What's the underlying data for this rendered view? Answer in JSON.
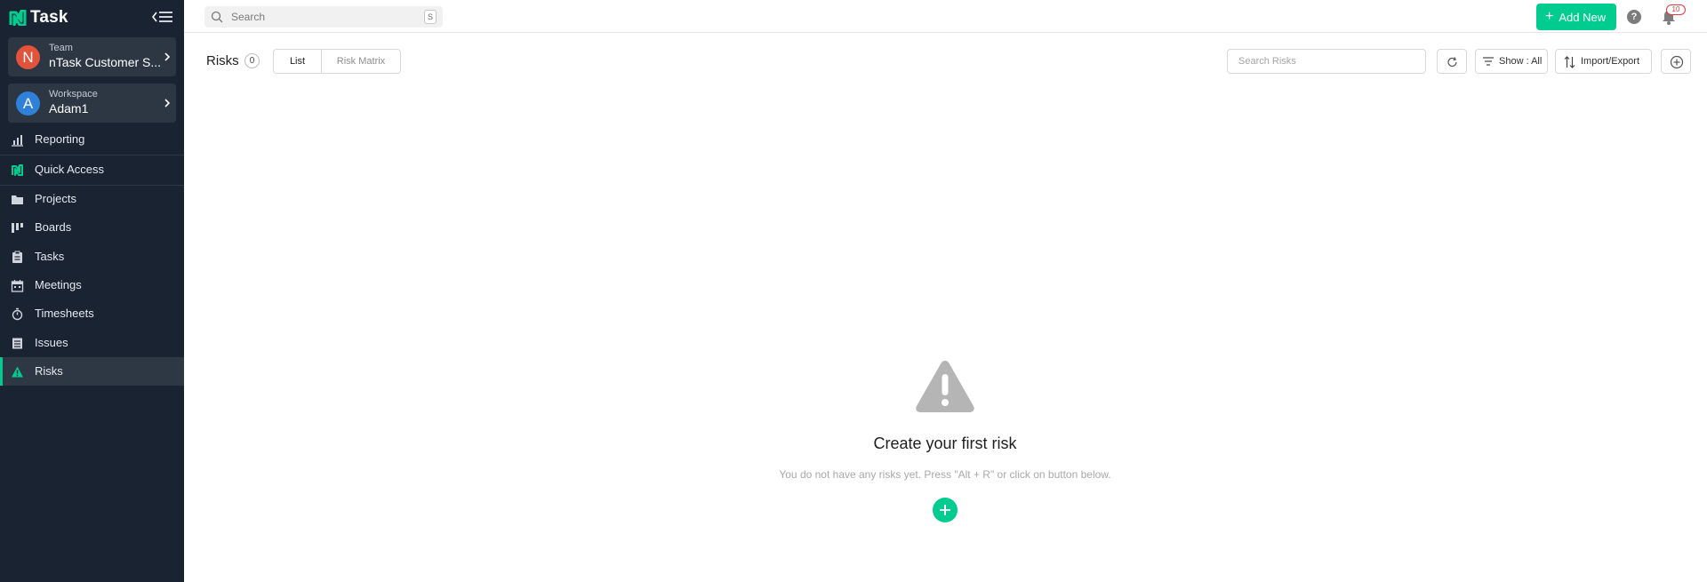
{
  "app": {
    "name": "Task"
  },
  "sidebar": {
    "team": {
      "small": "Team",
      "name": "nTask Customer S...",
      "avatar_initial": "N"
    },
    "workspace": {
      "small": "Workspace",
      "name": "Adam1",
      "avatar_initial": "A"
    },
    "items": [
      {
        "label": "Reporting",
        "icon": "chart-icon"
      },
      {
        "label": "Quick Access",
        "icon": "ntask-logo-icon"
      },
      {
        "label": "Projects",
        "icon": "folder-icon"
      },
      {
        "label": "Boards",
        "icon": "board-icon"
      },
      {
        "label": "Tasks",
        "icon": "clipboard-icon"
      },
      {
        "label": "Meetings",
        "icon": "calendar-icon"
      },
      {
        "label": "Timesheets",
        "icon": "stopwatch-icon"
      },
      {
        "label": "Issues",
        "icon": "list-icon"
      },
      {
        "label": "Risks",
        "icon": "warning-icon",
        "active": true
      }
    ]
  },
  "topbar": {
    "search_placeholder": "Search",
    "search_shortcut": "S",
    "add_new_label": "Add New",
    "help_label": "?",
    "notification_count": "10"
  },
  "header": {
    "title": "Risks",
    "count": "0",
    "tabs": [
      "List",
      "Risk Matrix"
    ],
    "search_placeholder": "Search Risks",
    "show_label": "Show : All",
    "import_export_label": "Import/Export"
  },
  "empty_state": {
    "title": "Create your first risk",
    "subtitle": "You do not have any risks yet. Press \"Alt + R\" or click on button below."
  },
  "colors": {
    "sidebar_bg": "#1a2331",
    "accent": "#00cc90",
    "badge_red": "#e23d3d"
  }
}
